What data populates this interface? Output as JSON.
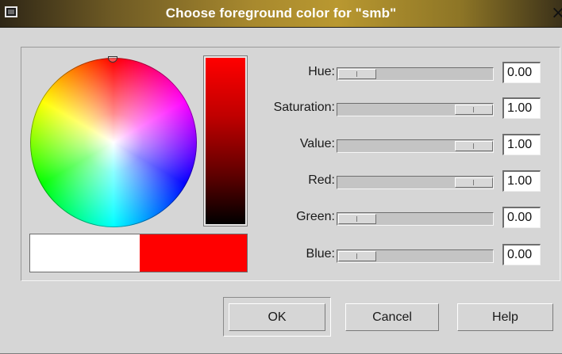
{
  "window": {
    "title": "Choose foreground color for \"smb\"",
    "close_glyph": "×",
    "icon": "window-menu-icon"
  },
  "color": {
    "current": "#ff0000",
    "previous": "#ffffff"
  },
  "sliders": [
    {
      "key": "hue",
      "label": "Hue:",
      "value": "0.00",
      "level": 0.0
    },
    {
      "key": "saturation",
      "label": "Saturation:",
      "value": "1.00",
      "level": 1.0
    },
    {
      "key": "value",
      "label": "Value:",
      "value": "1.00",
      "level": 1.0
    },
    {
      "key": "red",
      "label": "Red:",
      "value": "1.00",
      "level": 1.0
    },
    {
      "key": "green",
      "label": "Green:",
      "value": "0.00",
      "level": 0.0
    },
    {
      "key": "blue",
      "label": "Blue:",
      "value": "0.00",
      "level": 0.0
    }
  ],
  "buttons": {
    "ok": "OK",
    "cancel": "Cancel",
    "help": "Help"
  }
}
